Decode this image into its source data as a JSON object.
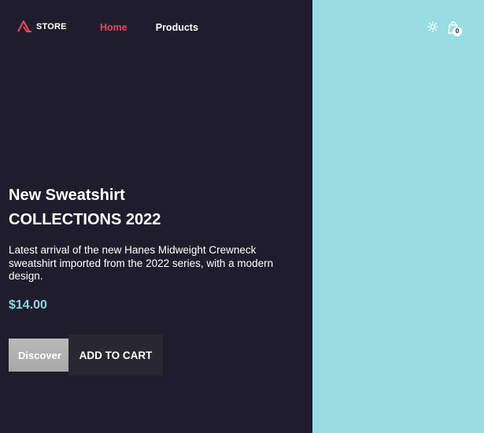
{
  "brand": {
    "label": "STORE",
    "accent_color": "#e8455e"
  },
  "nav": {
    "items": [
      {
        "label": "Home",
        "active": true
      },
      {
        "label": "Products",
        "active": false
      }
    ]
  },
  "header_actions": {
    "theme_icon": "sun-icon",
    "cart_icon": "shopping-bag-icon",
    "cart_count": "0"
  },
  "hero": {
    "title_line1": "New Sweatshirt",
    "title_line2": "COLLECTIONS 2022",
    "description": "Latest arrival of the new Hanes Midweight Crewneck sweatshirt imported from the 2022 series, with a modern design.",
    "price": "$14.00",
    "discover_label": "Discover",
    "add_to_cart_label": "ADD TO CART"
  },
  "colors": {
    "background_dark": "#1f1d2b",
    "panel_right": "#98dde1",
    "price": "#8ad4df"
  }
}
